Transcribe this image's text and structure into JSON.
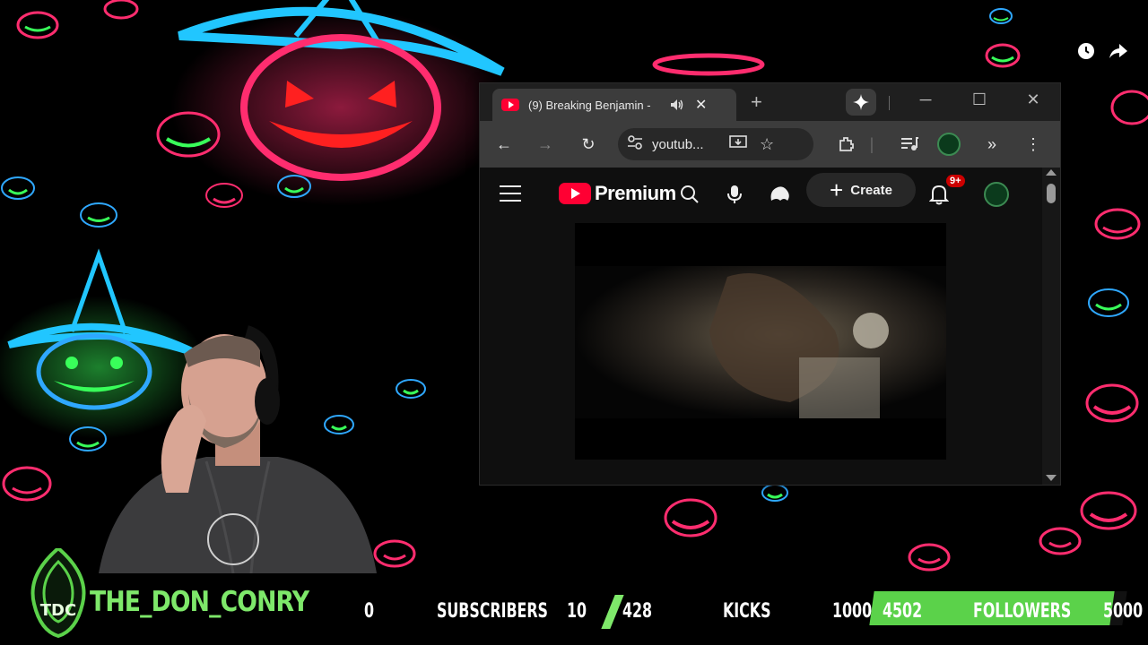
{
  "browser": {
    "tab_title": "(9) Breaking Benjamin -",
    "omnibox_text": "youtub..."
  },
  "youtube": {
    "logo_text": "Premium",
    "create_label": "Create",
    "notification_badge": "9+"
  },
  "stream_overlay": {
    "channel_name": "THE_DON_CONRY",
    "logo_text": "TDC",
    "subscribers": {
      "current": "0",
      "label": "SUBSCRIBERS",
      "goal": "10"
    },
    "kicks": {
      "current": "428",
      "label": "KICKS",
      "goal": "10000"
    },
    "followers": {
      "current": "4502",
      "label": "FOLLOWERS",
      "goal": "5000",
      "progress": 0.9
    }
  },
  "colors": {
    "accent_green": "#5bd24a",
    "youtube_red": "#ff0033",
    "browser_chrome": "#3c3c3c"
  }
}
